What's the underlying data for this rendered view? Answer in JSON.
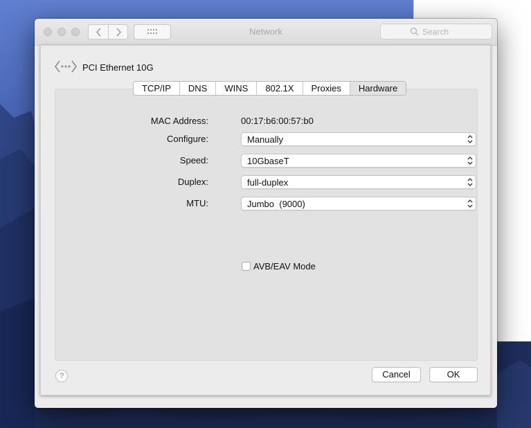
{
  "window": {
    "title": "Network",
    "search_placeholder": "Search"
  },
  "interface": {
    "name": "PCI Ethernet 10G",
    "icon": "ethernet-icon"
  },
  "tabs": [
    {
      "label": "TCP/IP",
      "active": false
    },
    {
      "label": "DNS",
      "active": false
    },
    {
      "label": "WINS",
      "active": false
    },
    {
      "label": "802.1X",
      "active": false
    },
    {
      "label": "Proxies",
      "active": false
    },
    {
      "label": "Hardware",
      "active": true
    }
  ],
  "hardware": {
    "mac_label": "MAC Address:",
    "mac_value": "00:17:b6:00:57:b0",
    "configure_label": "Configure:",
    "configure_value": "Manually",
    "speed_label": "Speed:",
    "speed_value": "10GbaseT",
    "duplex_label": "Duplex:",
    "duplex_value": "full-duplex",
    "mtu_label": "MTU:",
    "mtu_value": "Jumbo  (9000)",
    "avb_label": "AVB/EAV Mode",
    "avb_checked": false
  },
  "footer": {
    "help_glyph": "?",
    "cancel_label": "Cancel",
    "ok_label": "OK"
  }
}
